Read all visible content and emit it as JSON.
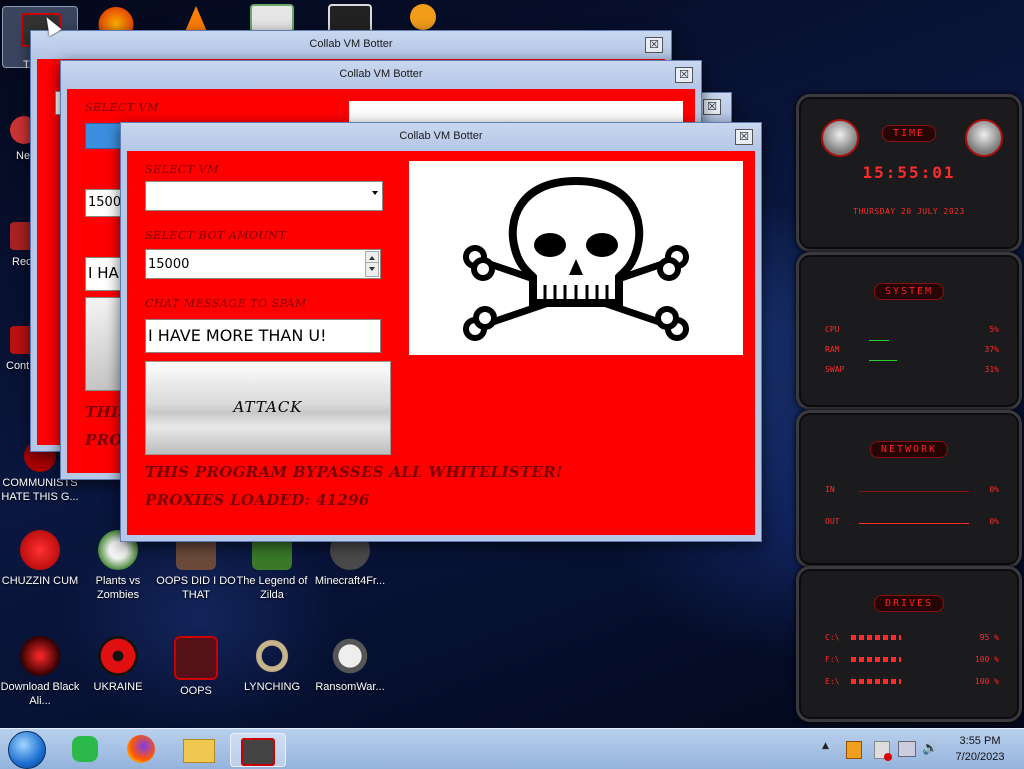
{
  "desktop": {
    "side_icons": [
      {
        "label": "Ne",
        "icon": "network-icon"
      },
      {
        "label": "Rec",
        "icon": "recycle-bin-icon"
      },
      {
        "label": "Cont",
        "icon": "control-panel-icon"
      }
    ],
    "top_partial_label": "Th",
    "icons": [
      {
        "label": "COMMUNISTS HATE THIS G...",
        "icon": "communist-icon"
      },
      {
        "label": "CHUZZIN CUM",
        "icon": "chuzzle-icon"
      },
      {
        "label": "Plants vs Zombies",
        "icon": "plants-vs-zombies-icon"
      },
      {
        "label": "OOPS DID I DO THAT",
        "icon": "portrait-icon"
      },
      {
        "label": "The Legend of Zilda",
        "icon": "zelda-icon"
      },
      {
        "label": "Minecraft4Fr...",
        "icon": "minecraft-icon"
      },
      {
        "label": "Download Black Ali...",
        "icon": "alienware-icon"
      },
      {
        "label": "UKRAINE",
        "icon": "radiation-icon"
      },
      {
        "label": "OOPS",
        "icon": "app-icon"
      },
      {
        "label": "LYNCHING",
        "icon": "noose-icon"
      },
      {
        "label": "RansomWar...",
        "icon": "skull-icon"
      }
    ]
  },
  "windows": {
    "title": "Collab VM Botter",
    "close_glyph": "☒",
    "back1": {
      "bot_amount": "1500",
      "chat": "I HA",
      "text1": "THIS",
      "text2": "PRO"
    },
    "back2": {
      "label": "SELECT VM"
    },
    "front": {
      "select_vm_label": "SELECT VM",
      "select_vm_value": "",
      "bot_amount_label": "SELECT BOT AMOUNT",
      "bot_amount_value": "15000",
      "chat_label": "CHAT MESSAGE TO SPAM",
      "chat_value": "I HAVE MORE THAN U!",
      "attack_button": "ATTACK",
      "bypass_text": "THIS PROGRAM BYPASSES ALL WHITELISTER!",
      "proxies_text": "PROXIES LOADED: 41296"
    }
  },
  "gadgets": {
    "time": {
      "title": "TIME",
      "clock": "15:55:01",
      "date": "THURSDAY 20 JULY 2023"
    },
    "system": {
      "title": "SYSTEM",
      "rows": [
        {
          "label": "CPU",
          "value": "5%"
        },
        {
          "label": "RAM",
          "value": "37%"
        },
        {
          "label": "SWAP",
          "value": "31%"
        }
      ]
    },
    "network": {
      "title": "NETWORK",
      "rows": [
        {
          "label": "IN",
          "value": "0%"
        },
        {
          "label": "OUT",
          "value": "0%"
        }
      ]
    },
    "drives": {
      "title": "DRIVES",
      "rows": [
        {
          "label": "C:\\",
          "value": "95 %"
        },
        {
          "label": "F:\\",
          "value": "100 %"
        },
        {
          "label": "E:\\",
          "value": "100 %"
        }
      ]
    }
  },
  "taskbar": {
    "time": "3:55 PM",
    "date": "7/20/2023",
    "show_hidden_glyph": "▲"
  },
  "colors": {
    "window_client": "#ff0000",
    "label_text": "#7a0000",
    "gadget_red": "#ff2a2a"
  }
}
